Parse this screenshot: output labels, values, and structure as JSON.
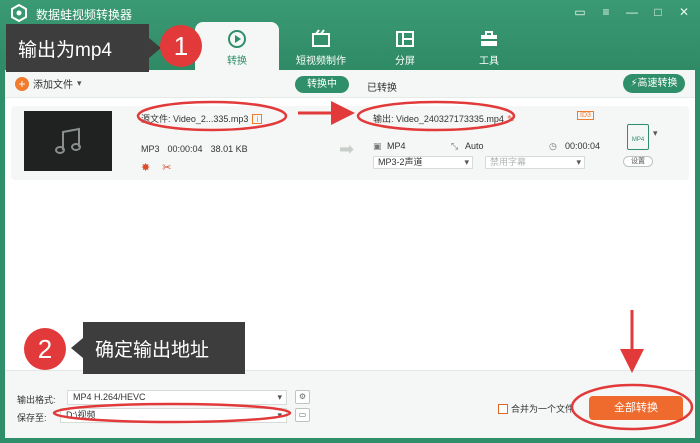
{
  "app": {
    "title": "数据蛙视频转换器"
  },
  "window_controls": [
    "chat-icon",
    "menu-icon",
    "minimize-icon",
    "maximize-icon",
    "close-icon"
  ],
  "tabs": [
    {
      "label": "转换",
      "icon": "convert-icon",
      "active": true
    },
    {
      "label": "短视频制作",
      "icon": "short-video-icon",
      "active": false
    },
    {
      "label": "分屏",
      "icon": "split-screen-icon",
      "active": false
    },
    {
      "label": "工具",
      "icon": "toolbox-icon",
      "active": false
    }
  ],
  "callouts": {
    "step1": {
      "number": "1",
      "text": "输出为mp4"
    },
    "step2": {
      "number": "2",
      "text": "确定输出地址"
    }
  },
  "toolbar": {
    "add_file": "添加文件",
    "converting": "转换中",
    "converted": "已转换",
    "fast_convert": "高速转换"
  },
  "file": {
    "source_label": "源文件: Video_2...335.mp3",
    "format": "MP3",
    "duration": "00:00:04",
    "size": "38.01 KB",
    "output_label": "输出: Video_240327173335.mp4",
    "id3_badge": "ID3",
    "out_format": "MP4",
    "out_resolution": "Auto",
    "out_duration": "00:00:04",
    "audio_track": "MP3-2声道",
    "subtitle": "禁用字幕",
    "format_card": "MP4",
    "settings": "设置"
  },
  "bottom": {
    "output_format_label": "输出格式:",
    "output_format_value": "MP4 H.264/HEVC",
    "save_to_label": "保存至:",
    "save_to_value": "D:\\视频",
    "merge_label": "合并为一个文件",
    "convert_all": "全部转换"
  },
  "colors": {
    "brand": "#2f8f6a",
    "accent": "#ef6b2d",
    "annotation": "#e23a3a"
  }
}
